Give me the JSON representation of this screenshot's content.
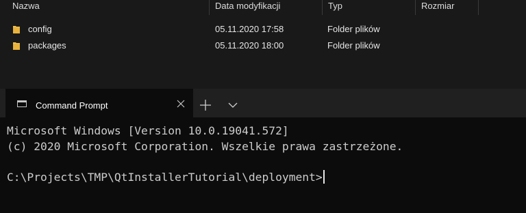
{
  "explorer": {
    "columns": [
      "Nazwa",
      "Data modyfikacji",
      "Typ",
      "Rozmiar"
    ],
    "rows": [
      {
        "name": "config",
        "modified": "05.11.2020 17:58",
        "type": "Folder plików",
        "size": ""
      },
      {
        "name": "packages",
        "modified": "05.11.2020 18:00",
        "type": "Folder plików",
        "size": ""
      }
    ],
    "folder_color": "#f0c050"
  },
  "terminal": {
    "tab_title": "Command Prompt",
    "tab_icon": "command-prompt-icon",
    "lines": [
      "Microsoft Windows [Version 10.0.19041.572]",
      "(c) 2020 Microsoft Corporation. Wszelkie prawa zastrzeżone.",
      "",
      "C:\\Projects\\TMP\\QtInstallerTutorial\\deployment>"
    ]
  }
}
